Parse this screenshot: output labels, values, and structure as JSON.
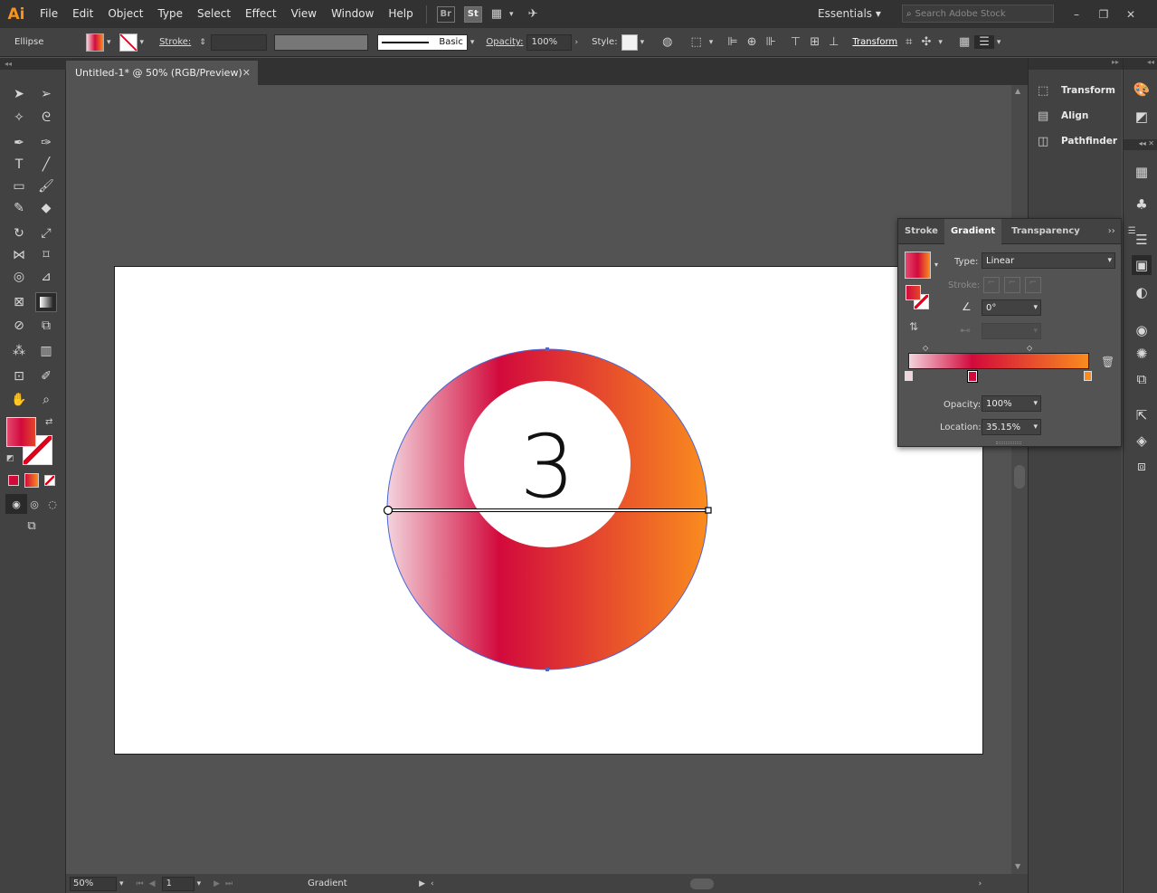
{
  "app": {
    "logo": "Ai"
  },
  "menu": [
    "File",
    "Edit",
    "Object",
    "Type",
    "Select",
    "Effect",
    "View",
    "Window",
    "Help"
  ],
  "topbar": {
    "bridge": "Br",
    "stock": "St",
    "workspace": "Essentials",
    "search_placeholder": "Search Adobe Stock",
    "win_min": "–",
    "win_restore": "❐",
    "win_close": "✕"
  },
  "control": {
    "object_type": "Ellipse",
    "stroke_label": "Stroke:",
    "brush_label": "Basic",
    "opacity_label": "Opacity:",
    "opacity_value": "100%",
    "style_label": "Style:",
    "transform_link": "Transform"
  },
  "document": {
    "tab_title": "Untitled-1* @ 50% (RGB/Preview)",
    "close": "✕"
  },
  "artwork": {
    "ball_number": "3",
    "gradient_start": "#f3d3dc",
    "gradient_mid": "#d20a3c",
    "gradient_end": "#fa8c1e"
  },
  "status": {
    "zoom": "50%",
    "artboard_num": "1",
    "tool_name": "Gradient"
  },
  "dock": {
    "items": [
      "Transform",
      "Align",
      "Pathfinder"
    ]
  },
  "gradient_panel": {
    "tabs": [
      "Stroke",
      "Gradient",
      "Transparency"
    ],
    "type_label": "Type:",
    "type_value": "Linear",
    "stroke_label": "Stroke:",
    "angle_value": "0°",
    "opacity_label": "Opacity:",
    "opacity_value": "100%",
    "location_label": "Location:",
    "location_value": "35.15%"
  },
  "colors": {
    "accent_fill": "#d20a3c",
    "ui_dark": "#323232",
    "ui_mid": "#424242",
    "ui_canvas": "#535353"
  }
}
